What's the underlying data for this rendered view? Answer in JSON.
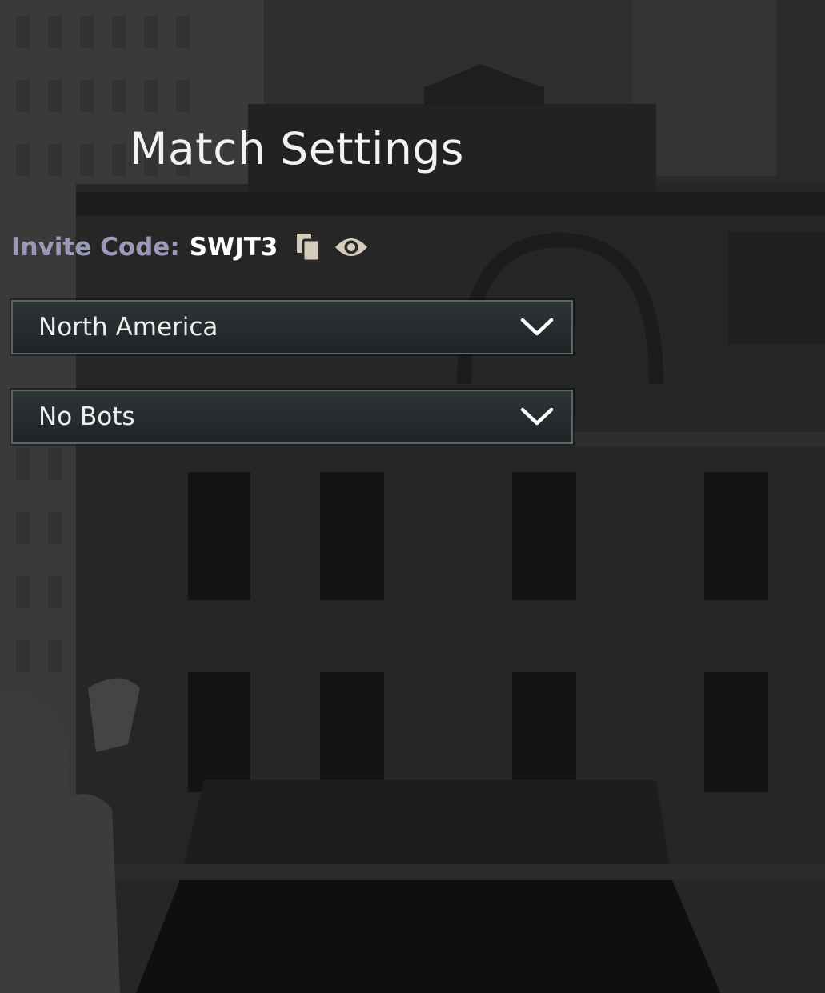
{
  "screen": {
    "title": "Match Settings"
  },
  "invite": {
    "label": "Invite Code:",
    "code": "SWJT3",
    "copy_icon": "copy-icon",
    "reveal_icon": "eye-icon"
  },
  "selects": {
    "region": {
      "value": "North America",
      "icon": "chevron-down-icon"
    },
    "bots": {
      "value": "No Bots",
      "icon": "chevron-down-icon"
    }
  },
  "colors": {
    "label": "#9a9ab8",
    "code": "#ffffff",
    "icon": "#d4cbbd",
    "select_border": "#5a6665",
    "select_bg": "#262c2e"
  }
}
